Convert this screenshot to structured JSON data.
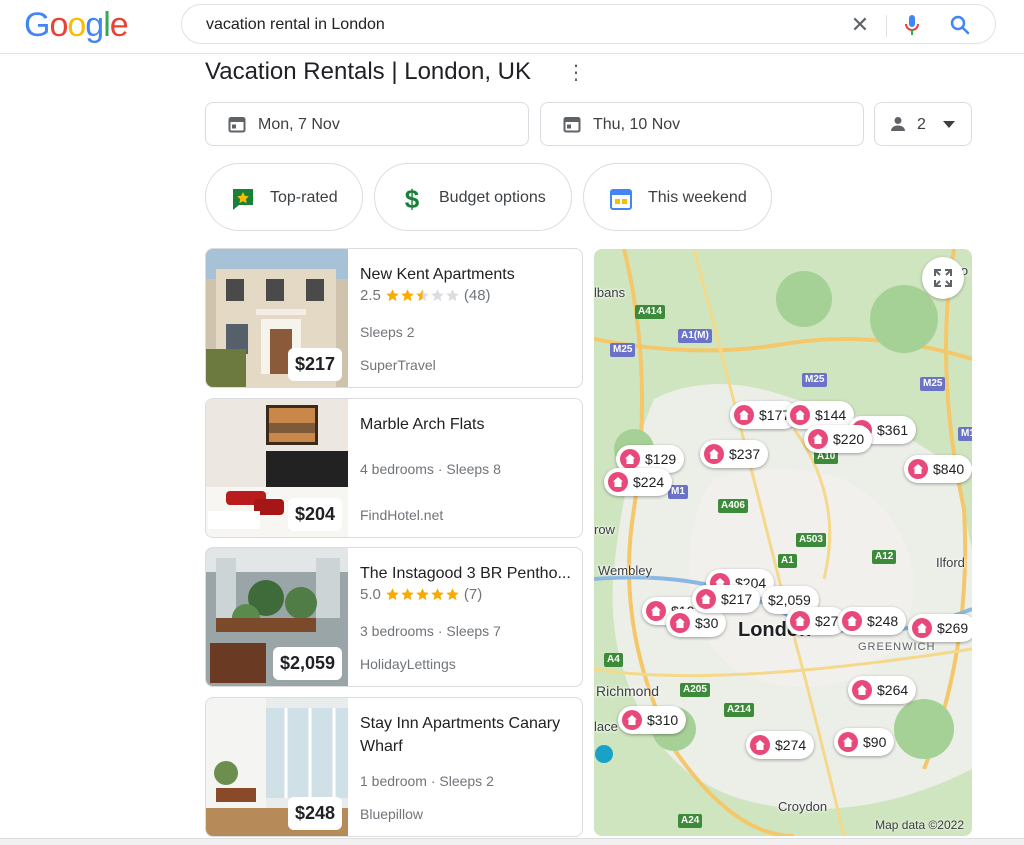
{
  "header": {
    "logo_letters": [
      {
        "ch": "G",
        "color": "#4285F4"
      },
      {
        "ch": "o",
        "color": "#EA4335"
      },
      {
        "ch": "o",
        "color": "#FBBC05"
      },
      {
        "ch": "g",
        "color": "#4285F4"
      },
      {
        "ch": "l",
        "color": "#34A853"
      },
      {
        "ch": "e",
        "color": "#EA4335"
      }
    ],
    "search_query": "vacation rental in London"
  },
  "title": "Vacation Rentals | London, UK",
  "dates": {
    "checkin": "Mon, 7 Nov",
    "checkout": "Thu, 10 Nov",
    "guests": "2"
  },
  "chips": [
    {
      "label": "Top-rated",
      "icon": "top-rated-icon"
    },
    {
      "label": "Budget options",
      "icon": "dollar-icon"
    },
    {
      "label": "This weekend",
      "icon": "calendar-icon"
    }
  ],
  "listings": [
    {
      "name": "New Kent Apartments",
      "rating": "2.5",
      "stars": 2.5,
      "reviews": "(48)",
      "meta": "Sleeps 2",
      "source": "SuperTravel",
      "price": "$217"
    },
    {
      "name": "Marble Arch Flats",
      "rating": "",
      "stars": 0,
      "reviews": "",
      "meta": "4 bedrooms · Sleeps 8",
      "source": "FindHotel.net",
      "price": "$204"
    },
    {
      "name": "The Instagood 3 BR Pentho...",
      "rating": "5.0",
      "stars": 5,
      "reviews": "(7)",
      "meta": "3 bedrooms · Sleeps 7",
      "source": "HolidayLettings",
      "price": "$2,059"
    },
    {
      "name": "Stay Inn Apartments Canary Wharf",
      "rating": "",
      "stars": 0,
      "reviews": "",
      "meta": "1 bedroom · Sleeps 2",
      "source": "Bluepillow",
      "price": "$248"
    }
  ],
  "map": {
    "pins": [
      "$177",
      "$144",
      "$220",
      "$361",
      "$129",
      "$237",
      "$224",
      "$840",
      "$204",
      "$217",
      "$2,059",
      "$107",
      "$30",
      "$27",
      "$248",
      "$269",
      "$264",
      "$310",
      "$274",
      "$90"
    ],
    "places": [
      "lbans",
      "Wembley",
      "Ilford",
      "row",
      "London",
      "GREENWICH",
      "Richmond",
      "Croydon",
      "lace",
      "lo"
    ],
    "roads": [
      "A414",
      "A1(M)",
      "M25",
      "M25",
      "M25",
      "M1",
      "M1",
      "A10",
      "A406",
      "A503",
      "A1",
      "A12",
      "A4",
      "A205",
      "A214",
      "A24"
    ],
    "attribution": "Map data ©2022"
  }
}
